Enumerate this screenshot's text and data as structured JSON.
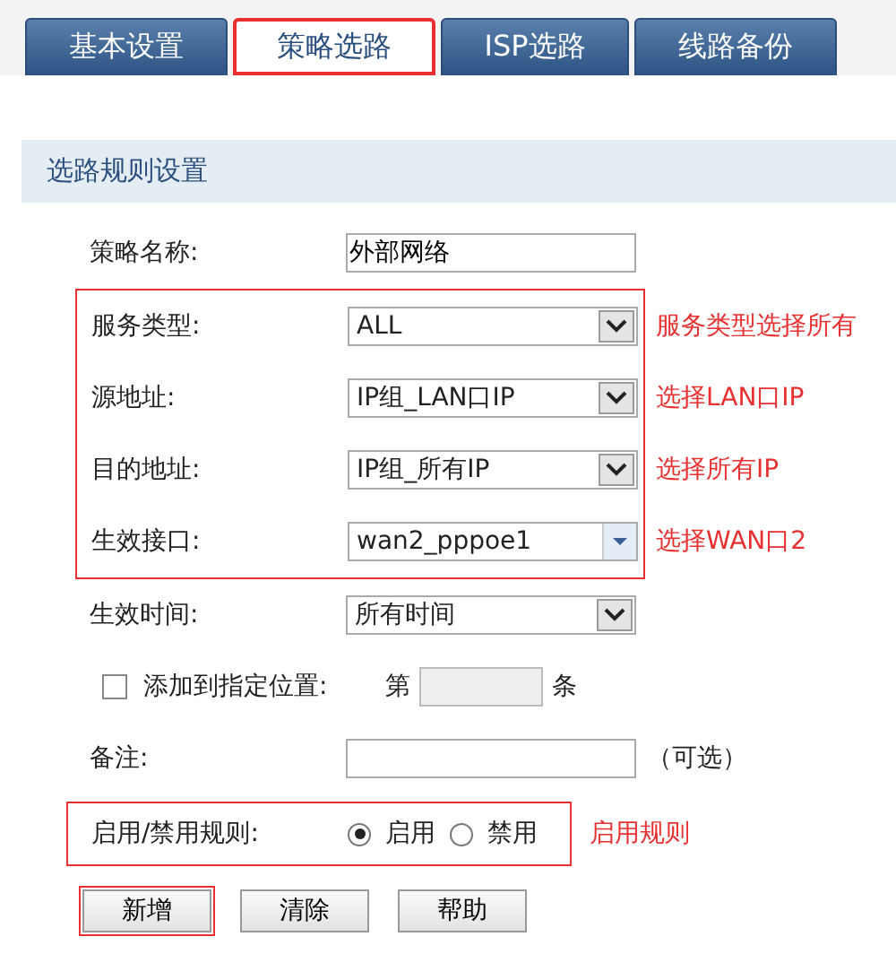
{
  "tabs": [
    {
      "label": "基本设置",
      "selected": false,
      "highlighted": false
    },
    {
      "label": "策略选路",
      "selected": true,
      "highlighted": true
    },
    {
      "label": "ISP选路",
      "selected": false,
      "highlighted": false
    },
    {
      "label": "线路备份",
      "selected": false,
      "highlighted": false
    }
  ],
  "section": {
    "title": "选路规则设置"
  },
  "rows": [
    {
      "kind": "text",
      "label": "策略名称:",
      "value": "外部网络"
    },
    {
      "kind": "group",
      "highlighted": true,
      "rows": [
        {
          "kind": "dropdown",
          "label": "服务类型:",
          "value": "ALL",
          "note": "服务类型选择所有"
        },
        {
          "kind": "dropdown",
          "label": "源地址:",
          "value": "IP组_LAN口IP",
          "note": "选择LAN口IP"
        },
        {
          "kind": "dropdown",
          "label": "目的地址:",
          "value": "IP组_所有IP",
          "note": "选择所有IP"
        },
        {
          "kind": "combo",
          "label": "生效接口:",
          "value": "wan2_pppoe1",
          "note": "选择WAN口2"
        }
      ]
    },
    {
      "kind": "dropdown",
      "label": "生效时间:",
      "value": "所有时间"
    },
    {
      "kind": "position",
      "label": "添加到指定位置:",
      "checked": false,
      "prefix": "第",
      "suffix": "条"
    },
    {
      "kind": "text",
      "label": "备注:",
      "value": "",
      "hint": "（可选）"
    },
    {
      "kind": "radio",
      "label": "启用/禁用规则:",
      "highlighted": true,
      "note": "启用规则",
      "options": [
        {
          "label": "启用",
          "selected": true
        },
        {
          "label": "禁用",
          "selected": false
        }
      ]
    }
  ],
  "buttons": [
    {
      "label": "新增",
      "highlighted": true
    },
    {
      "label": "清除",
      "highlighted": false
    },
    {
      "label": "帮助",
      "highlighted": false
    }
  ]
}
